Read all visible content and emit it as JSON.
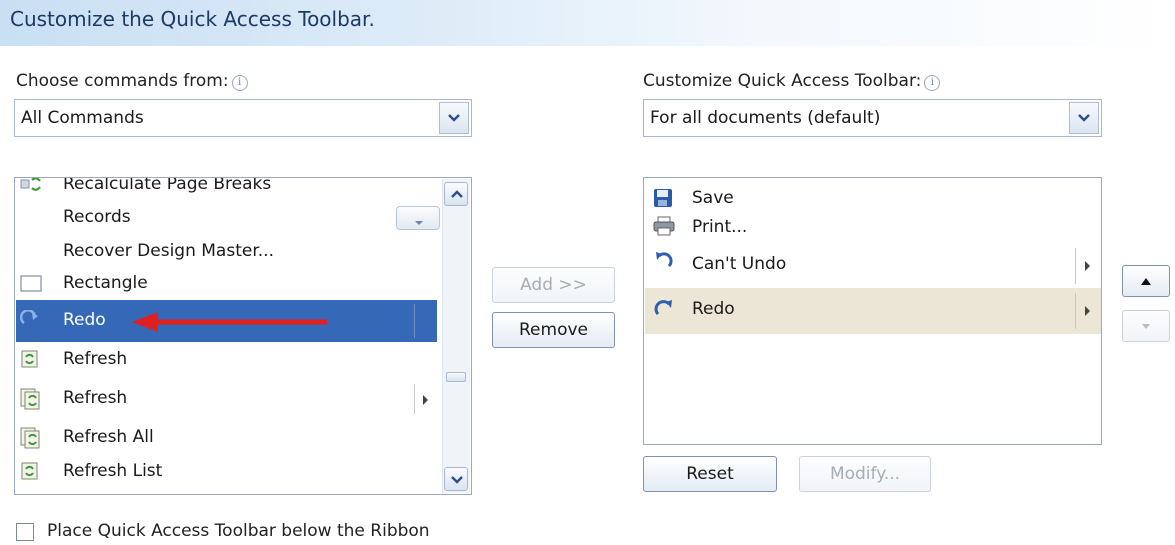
{
  "header": {
    "title": "Customize the Quick Access Toolbar."
  },
  "left": {
    "label": "Choose commands from:",
    "combo_value": "All Commands",
    "items": [
      {
        "label": "Recalculate Page Breaks",
        "icon": "page-breaks-icon"
      },
      {
        "label": "Records",
        "icon": "none"
      },
      {
        "label": "Recover Design Master...",
        "icon": "none"
      },
      {
        "label": "Rectangle",
        "icon": "rectangle-icon"
      },
      {
        "label": "Redo",
        "icon": "redo-icon"
      },
      {
        "label": "Refresh",
        "icon": "refresh-icon"
      },
      {
        "label": "Refresh",
        "icon": "refresh-all-icon"
      },
      {
        "label": "Refresh All",
        "icon": "refresh-all-icon"
      },
      {
        "label": "Refresh List",
        "icon": "refresh-icon"
      }
    ],
    "selected_item": "Redo"
  },
  "buttons": {
    "add": "Add >>",
    "remove": "Remove",
    "reset": "Reset",
    "modify": "Modify..."
  },
  "right": {
    "label": "Customize Quick Access Toolbar:",
    "combo_value": "For all documents (default)",
    "items": [
      {
        "label": "Save",
        "icon": "save-icon"
      },
      {
        "label": "Print...",
        "icon": "print-icon"
      },
      {
        "label": "Can't Undo",
        "icon": "undo-icon"
      },
      {
        "label": "Redo",
        "icon": "redo-icon"
      }
    ]
  },
  "checkbox": {
    "label": "Place Quick Access Toolbar below the Ribbon",
    "checked": false
  },
  "colors": {
    "selection": "#3569b8",
    "highlight": "#ece6d7",
    "annotation_arrow": "#e02020"
  }
}
